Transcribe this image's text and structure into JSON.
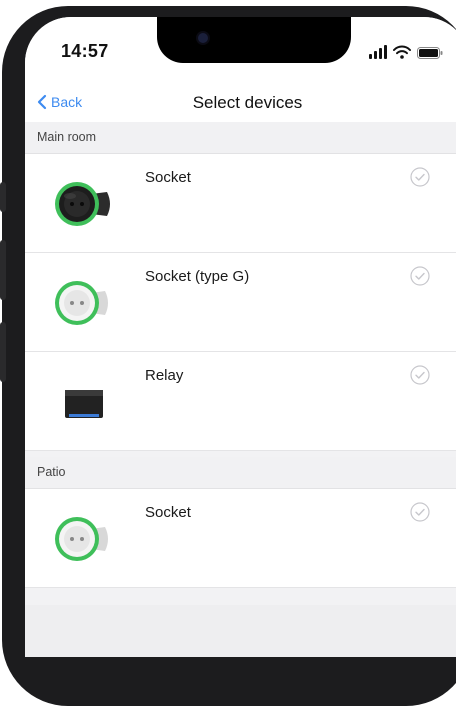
{
  "status_bar": {
    "time": "14:57"
  },
  "nav": {
    "back_label": "Back",
    "title": "Select devices"
  },
  "sections": [
    {
      "label": "Main room",
      "devices": [
        {
          "name": "Socket",
          "icon": "socket-black-icon",
          "selected": false
        },
        {
          "name": "Socket (type G)",
          "icon": "socket-white-icon",
          "selected": false
        },
        {
          "name": "Relay",
          "icon": "relay-icon",
          "selected": false
        }
      ]
    },
    {
      "label": "Patio",
      "devices": [
        {
          "name": "Socket",
          "icon": "socket-white-icon",
          "selected": false
        }
      ]
    }
  ],
  "colors": {
    "accent": "#3d8bf0",
    "led_green": "#3fbf5a",
    "check_gray": "#c7c7cc"
  }
}
